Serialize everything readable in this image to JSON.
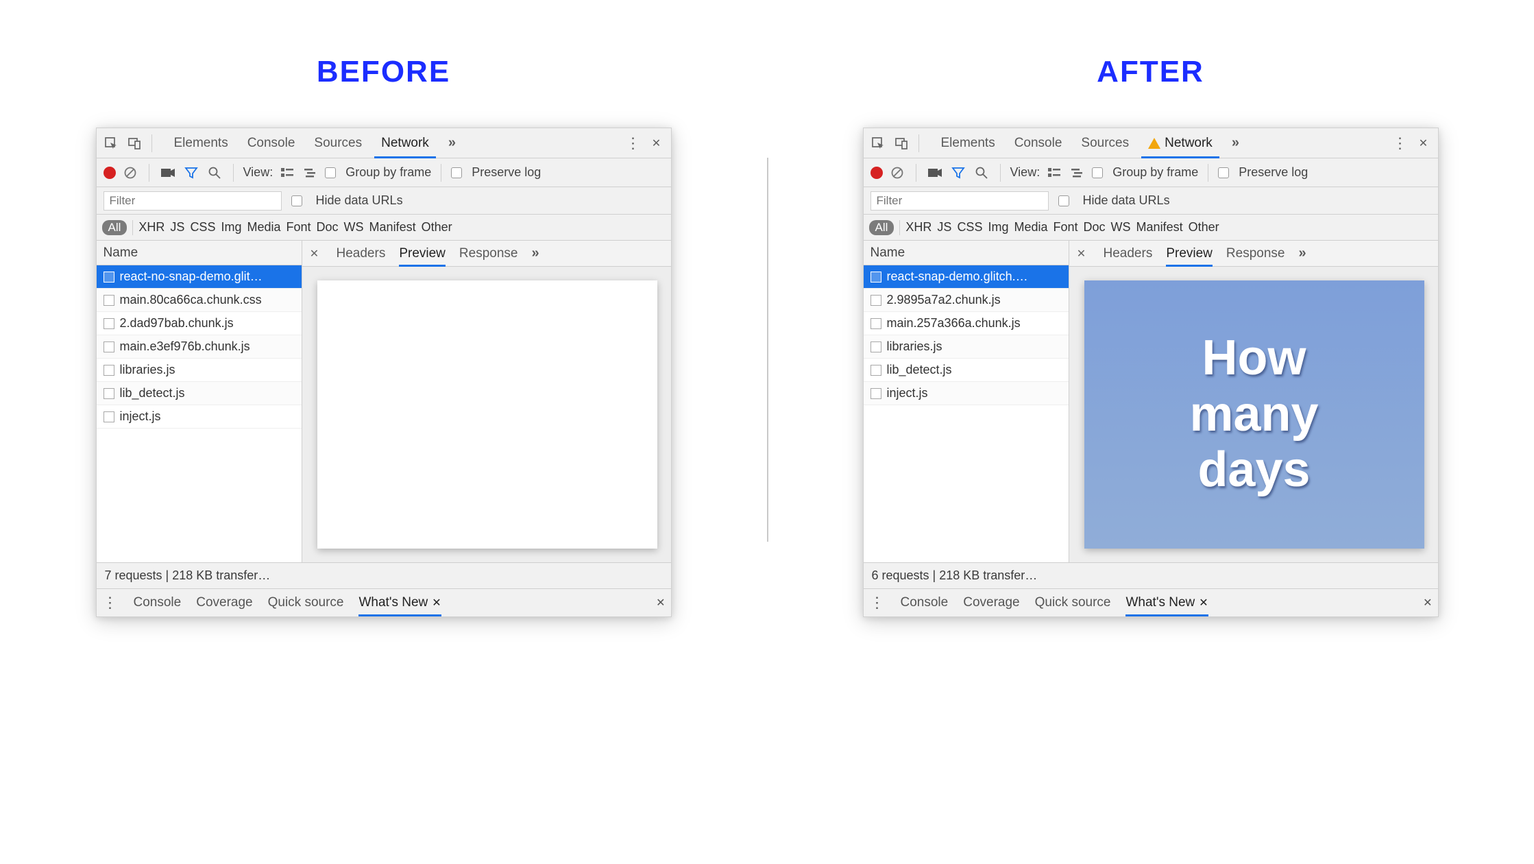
{
  "headings": {
    "before": "BEFORE",
    "after": "AFTER"
  },
  "topTabs": {
    "elements": "Elements",
    "console": "Console",
    "sources": "Sources",
    "network": "Network"
  },
  "toolbar": {
    "view": "View:",
    "groupByFrame": "Group by frame",
    "preserveLog": "Preserve log"
  },
  "filterRow": {
    "placeholder": "Filter",
    "hideDataUrls": "Hide data URLs"
  },
  "typeChips": {
    "all": "All",
    "xhr": "XHR",
    "js": "JS",
    "css": "CSS",
    "img": "Img",
    "media": "Media",
    "font": "Font",
    "doc": "Doc",
    "ws": "WS",
    "manifest": "Manifest",
    "other": "Other"
  },
  "requestListHeader": "Name",
  "detailTabs": {
    "headers": "Headers",
    "preview": "Preview",
    "response": "Response"
  },
  "drawer": {
    "console": "Console",
    "coverage": "Coverage",
    "quicksource": "Quick source",
    "whatsnew": "What's New"
  },
  "before": {
    "requests": [
      "react-no-snap-demo.glit…",
      "main.80ca66ca.chunk.css",
      "2.dad97bab.chunk.js",
      "main.e3ef976b.chunk.js",
      "libraries.js",
      "lib_detect.js",
      "inject.js"
    ],
    "status": "7 requests | 218 KB transfer…",
    "previewLines": []
  },
  "after": {
    "requests": [
      "react-snap-demo.glitch.…",
      "2.9895a7a2.chunk.js",
      "main.257a366a.chunk.js",
      "libraries.js",
      "lib_detect.js",
      "inject.js"
    ],
    "status": "6 requests | 218 KB transfer…",
    "previewLines": [
      "How",
      "many",
      "days"
    ]
  }
}
